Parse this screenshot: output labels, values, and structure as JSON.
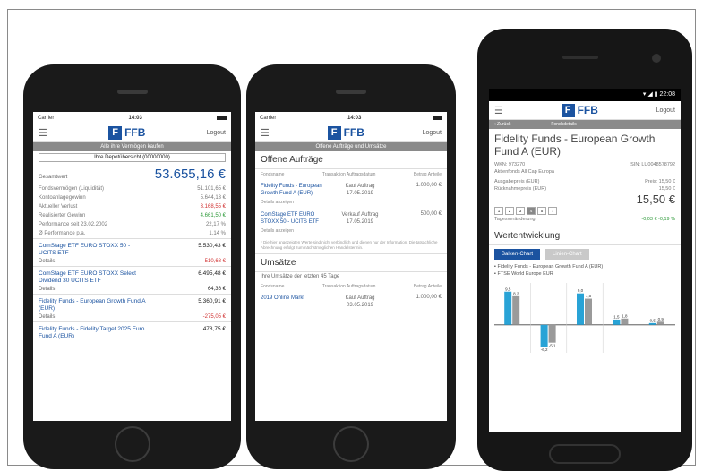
{
  "phone1": {
    "status": {
      "carrier": "Carrier",
      "time": "14:03"
    },
    "logo_text": "FFB",
    "logout": "Logout",
    "grey_bar": "Alle ihre Vermögen kaufen",
    "depot": "Ihre Depotübersicht (00000000)",
    "total_label": "Gesamtwert",
    "total_value": "53.655,16 €",
    "rows": [
      {
        "label": "Fondsvermögen (Liquidität)",
        "value": "51.101,65 €",
        "cls": ""
      },
      {
        "label": "Kontoanlagegewinn",
        "value": "5.644,13 €",
        "cls": ""
      },
      {
        "label": "Aktueller Verlust",
        "value": "3.168,55 €",
        "cls": "red"
      },
      {
        "label": "Realisierter Gewinn",
        "value": "4.661,50 €",
        "cls": "green"
      },
      {
        "label": "Performance seit 23.02.2002",
        "value": "22,17 %",
        "cls": ""
      },
      {
        "label": "Ø Performance p.a.",
        "value": "1,14 %",
        "cls": ""
      }
    ],
    "funds": [
      {
        "name": "ComStage ETF EURO STOXX 50 - UCITS ETF",
        "value": "5.530,43 €",
        "detail": "Details",
        "change": "-510,68 €",
        "cls": "red"
      },
      {
        "name": "ComStage ETF EURO STOXX Select Dividend 30 UCITS ETF",
        "value": "6.495,48 €",
        "detail": "Details",
        "change": "64,36 €",
        "cls": ""
      },
      {
        "name": "Fidelity Funds - European Growth Fund A (EUR)",
        "value": "5.360,91 €",
        "detail": "Details",
        "change": "-275,05 €",
        "cls": "red"
      },
      {
        "name": "Fidelity Funds - Fidelity Target 2025 Euro Fund A (EUR)",
        "value": "478,75 €",
        "detail": "",
        "change": "",
        "cls": ""
      }
    ]
  },
  "phone2": {
    "status": {
      "carrier": "Carrier",
      "time": "14:03"
    },
    "logo_text": "FFB",
    "logout": "Logout",
    "grey_bar": "Offene Aufträge und Umsätze",
    "section1_title": "Offene Aufträge",
    "col_headers": [
      "Fondsname",
      "Transaktion Auftragsdatum",
      "Betrag Anteile"
    ],
    "orders": [
      {
        "name": "Fidelity Funds - European Growth Fund A (EUR)",
        "type": "Kauf Auftrag",
        "date": "17.05.2019",
        "amount": "1.000,00 €",
        "link": "Details anzeigen"
      },
      {
        "name": "ComStage ETF EURO STOXX 50 - UCITS ETF",
        "type": "Verkauf Auftrag",
        "date": "17.05.2019",
        "amount": "500,00 €",
        "link": "Details anzeigen"
      }
    ],
    "note": "* Die hier angezeigten Werte sind nicht verbindlich und dienen nur der Information. Die tatsächliche Abrechnung erfolgt zum nächstmöglichen Handelstermin.",
    "section2_title": "Umsätze",
    "section2_sub": "Ihre Umsätze der letzten 45 Tage",
    "turnover": [
      {
        "name": "2019 Online Markt",
        "type": "Kauf Auftrag",
        "date": "03.05.2019",
        "amount": "1.000,00 €"
      }
    ]
  },
  "android": {
    "status_time": "22:08",
    "logo_text": "FFB",
    "logout": "Logout",
    "back": "‹ Zurück",
    "subnav_title": "Fondsdetails",
    "fund_title": "Fidelity Funds - European Growth Fund A (EUR)",
    "wkn": "WKN: 973270",
    "isin": "ISIN: LU0048578792",
    "kag": "Aktienfonds All Cap Europa",
    "rows": [
      {
        "label": "Ausgabepreis (EUR)",
        "value": "Preis: 15,50 €"
      },
      {
        "label": "Rücknahmepreis (EUR)",
        "value": "15,50 €"
      }
    ],
    "price": "15,50 €",
    "change_label": "Tagesveränderung",
    "change_value": "-0,03 €",
    "change_pct": "-0,19 %",
    "pager": [
      "1",
      "2",
      "3",
      "4",
      "5",
      "›"
    ],
    "pager_active": 3,
    "section": "Wertentwicklung",
    "btn_bar": "Balken-Chart",
    "btn_line": "Linien-Chart",
    "legend": [
      "Fidelity Funds - European Growth Fund A (EUR)",
      "FTSE World Europe EUR"
    ],
    "chart_data": {
      "type": "bar",
      "series": [
        {
          "name": "Fidelity Funds - European Growth Fund A (EUR)",
          "values": [
            9.5,
            -6.2,
            9.0,
            1.5,
            0.5
          ]
        },
        {
          "name": "FTSE World Europe EUR",
          "values": [
            8.2,
            -5.1,
            7.5,
            1.8,
            0.9
          ]
        }
      ],
      "labels1": [
        "9,5",
        "-6,2",
        "9,0",
        "1,5",
        "0,5"
      ],
      "labels2": [
        "8,2",
        "-5,1",
        "7,5",
        "1,8",
        "0,9"
      ],
      "colors": [
        "#29a3d6",
        "#9a9a9a"
      ],
      "ylim": [
        -8,
        12
      ]
    }
  }
}
